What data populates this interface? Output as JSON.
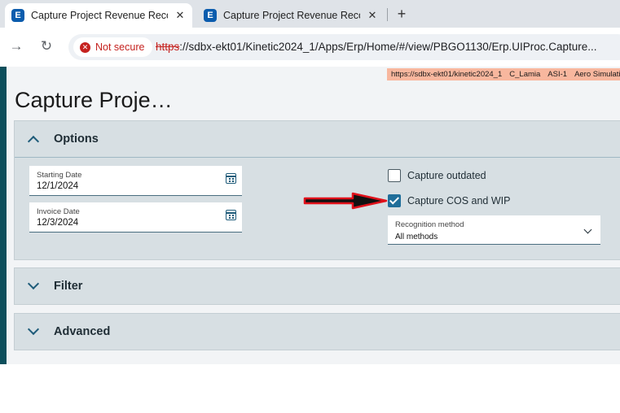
{
  "browser": {
    "tabs": [
      {
        "label": "Capture Project Revenue Recognition",
        "favicon": "E",
        "active": true
      },
      {
        "label": "Capture Project Revenue Recognition",
        "favicon": "E",
        "active": false
      }
    ],
    "new_tab": "+",
    "close_glyph": "✕",
    "security_label": "Not secure",
    "url_scheme": "https",
    "url_rest": "://sdbx-ekt01/Kinetic2024_1/Apps/Erp/Home/#/view/PBGO1130/Erp.UIProc.Capture...",
    "back_glyph": "→",
    "reload_glyph": "↻"
  },
  "env_strip": {
    "items": [
      "https://sdbx-ekt01/kinetic2024_1",
      "C_Lamia",
      "ASI-1",
      "Aero Simulation"
    ],
    "color": "#f8b79e"
  },
  "page": {
    "title": "Capture Proje…"
  },
  "options": {
    "header": "Options",
    "starting_date_label": "Starting Date",
    "starting_date_value": "12/1/2024",
    "invoice_date_label": "Invoice Date",
    "invoice_date_value": "12/3/2024",
    "capture_outdated_label": "Capture outdated",
    "capture_outdated_checked": false,
    "capture_cos_label": "Capture COS and WIP",
    "capture_cos_checked": true,
    "recognition_label": "Recognition method",
    "recognition_value": "All methods"
  },
  "filter": {
    "header": "Filter"
  },
  "advanced": {
    "header": "Advanced"
  },
  "colors": {
    "accent": "#1f6e9a",
    "panel_bg": "#d7dfe3",
    "left_bar": "#0d4f5c",
    "annotation_arrow": "#e0111b"
  }
}
